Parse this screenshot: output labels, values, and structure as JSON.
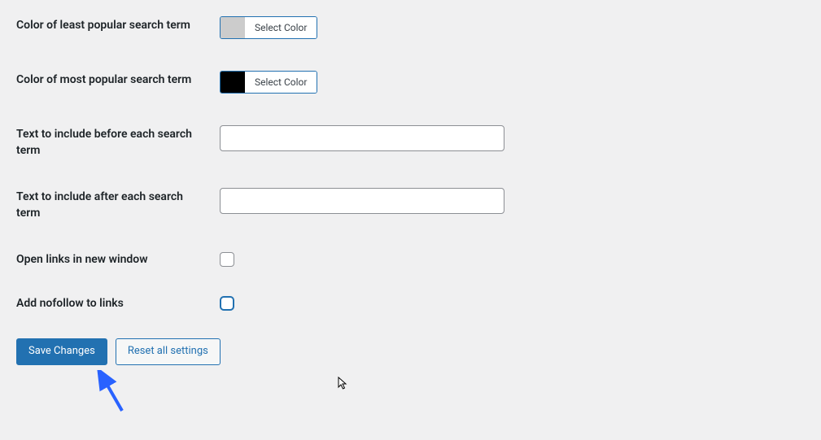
{
  "fields": {
    "color_least_popular": {
      "label": "Color of least popular search term",
      "button": "Select Color",
      "value": "#cccccc"
    },
    "color_most_popular": {
      "label": "Color of most popular search term",
      "button": "Select Color",
      "value": "#000000"
    },
    "text_before": {
      "label": "Text to include before each search term",
      "value": ""
    },
    "text_after": {
      "label": "Text to include after each search term",
      "value": ""
    },
    "open_new_window": {
      "label": "Open links in new window",
      "checked": false
    },
    "add_nofollow": {
      "label": "Add nofollow to links",
      "checked": false
    }
  },
  "buttons": {
    "save": "Save Changes",
    "reset": "Reset all settings"
  }
}
